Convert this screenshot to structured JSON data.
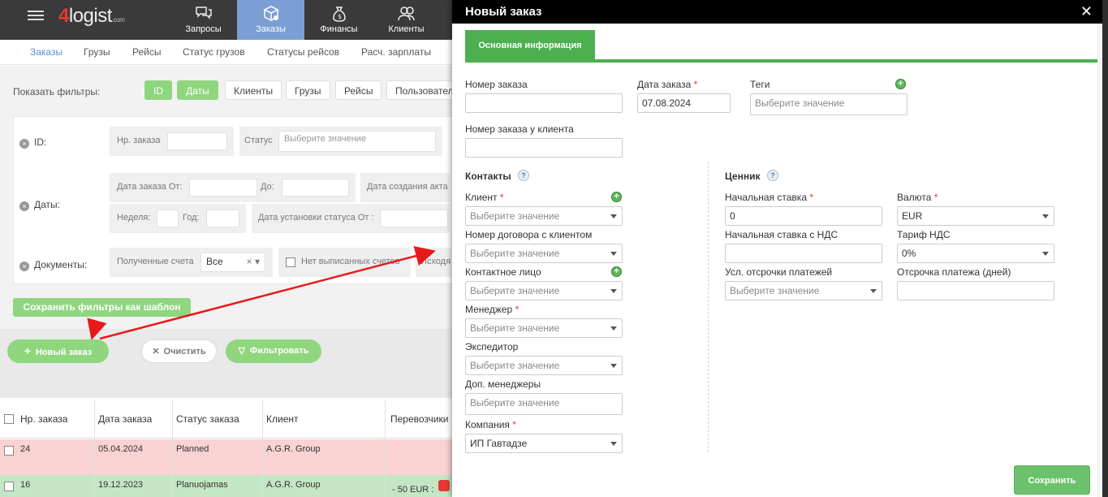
{
  "app": {
    "logo": "4logist",
    "logo_suffix": ".com",
    "nav": [
      {
        "label": "Запросы",
        "icon": "chat-icon"
      },
      {
        "label": "Заказы",
        "icon": "orders-box-icon"
      },
      {
        "label": "Финансы",
        "icon": "money-bag-icon"
      },
      {
        "label": "Клиенты",
        "icon": "users-icon"
      }
    ],
    "subnav": [
      "Заказы",
      "Грузы",
      "Рейсы",
      "Статус грузов",
      "Статусы рейсов",
      "Расч. зарплаты"
    ]
  },
  "filters": {
    "show_label": "Показать фильтры:",
    "chips": [
      "ID",
      "Даты",
      "Клиенты",
      "Грузы",
      "Рейсы",
      "Пользовател"
    ],
    "id_row": {
      "label": "ID:",
      "order_no": "Нр. заказа",
      "status": "Статус",
      "status_placeholder": "Выберите значение"
    },
    "dates_row": {
      "label": "Даты:",
      "order_date_from": "Дата заказа От:",
      "to": "До:",
      "act_created": "Дата создания акта",
      "week": "Неделя:",
      "year": "Год:",
      "status_set_from": "Дата установки статуса От :"
    },
    "docs_row": {
      "label": "Документы:",
      "received_invoices": "Полученные счета",
      "received_value": "Все",
      "not_issued": "Нет выписанных счетов",
      "outgoing": "Исходя"
    },
    "save_template": "Сохранить фильтры как шаблон"
  },
  "actions": {
    "new_order": "Новый заказ",
    "clear": "Очистить",
    "filter": "Фильтровать"
  },
  "table": {
    "columns": [
      "Нр. заказа",
      "Дата заказа",
      "Статус заказа",
      "Клиент",
      "Перевозчики"
    ],
    "rows": [
      {
        "no": "24",
        "date": "05.04.2024",
        "status": "Planned",
        "client": "A.G.R. Group",
        "carrier": ""
      },
      {
        "no": "16",
        "date": "19.12.2023",
        "status": "Planuojamas",
        "client": "A.G.R. Group",
        "carrier": "- 50 EUR :"
      }
    ],
    "row_colors": {
      "planned": "#f9d2d2",
      "planuojamas": "#c4e6c4"
    }
  },
  "modal": {
    "title": "Новый заказ",
    "tab": "Основная информация",
    "fields": {
      "order_number": {
        "label": "Номер заказа",
        "value": ""
      },
      "order_date": {
        "label": "Дата заказа",
        "value": "07.08.2024"
      },
      "tags": {
        "label": "Теги",
        "placeholder": "Выберите значение"
      },
      "client_order_number": {
        "label": "Номер заказа у клиента",
        "value": ""
      }
    },
    "contacts": {
      "title": "Контакты",
      "client": {
        "label": "Клиент",
        "placeholder": "Выберите значение"
      },
      "contract": {
        "label": "Номер договора с клиентом",
        "placeholder": "Выберите значение"
      },
      "contact_person": {
        "label": "Контактное лицо",
        "placeholder": "Выберите значение"
      },
      "manager": {
        "label": "Менеджер",
        "placeholder": "Выберите значение"
      },
      "forwarder": {
        "label": "Экспедитор",
        "placeholder": "Выберите значение"
      },
      "extra_managers": {
        "label": "Доп. менеджеры",
        "placeholder": "Выберите значение"
      },
      "company": {
        "label": "Компания",
        "value": "ИП Гавтадзе"
      }
    },
    "pricing": {
      "title": "Ценник",
      "initial_rate": {
        "label": "Начальная ставка",
        "value": "0"
      },
      "currency": {
        "label": "Валюта",
        "value": "EUR"
      },
      "initial_rate_vat": {
        "label": "Начальная ставка с НДС",
        "value": ""
      },
      "vat_rate": {
        "label": "Тариф НДС",
        "value": "0%"
      },
      "payment_terms": {
        "label": "Усл. отсрочки платежей",
        "placeholder": "Выберите значение"
      },
      "payment_delay": {
        "label": "Отсрочка платежа (дней)",
        "value": ""
      }
    },
    "save": "Сохранить",
    "required_mark": "*",
    "help_mark": "?"
  },
  "colors": {
    "accent_green": "#4caf50",
    "topbar": "#3a3a3a",
    "active_nav": "#7b9fd4",
    "annotation_arrow": "#e8191b"
  }
}
